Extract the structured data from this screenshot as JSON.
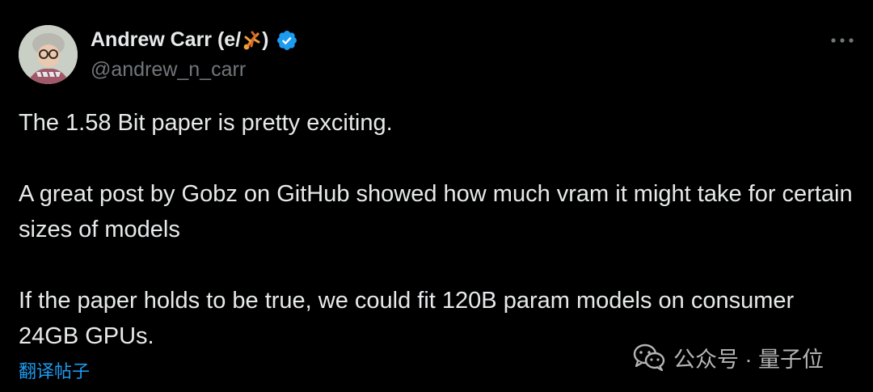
{
  "tweet": {
    "display_name": "Andrew Carr (e/",
    "display_name_close": ")",
    "name_emoji_icon": "person-doing-cartwheel-icon",
    "handle": "@andrew_n_carr",
    "paragraphs": [
      "The 1.58 Bit paper is pretty exciting.",
      "A great post by Gobz on GitHub showed how much vram it might take for certain sizes of models",
      "If the paper holds to be true, we could fit 120B param models on consumer 24GB GPUs."
    ],
    "translate_label": "翻译帖子"
  },
  "watermark": {
    "text": "公众号 · 量子位",
    "icon": "wechat-icon"
  },
  "colors": {
    "background": "#000000",
    "text": "#e7e9ea",
    "secondary_text": "#71767b",
    "accent": "#1d9bf0",
    "verified": "#1d9bf0"
  }
}
